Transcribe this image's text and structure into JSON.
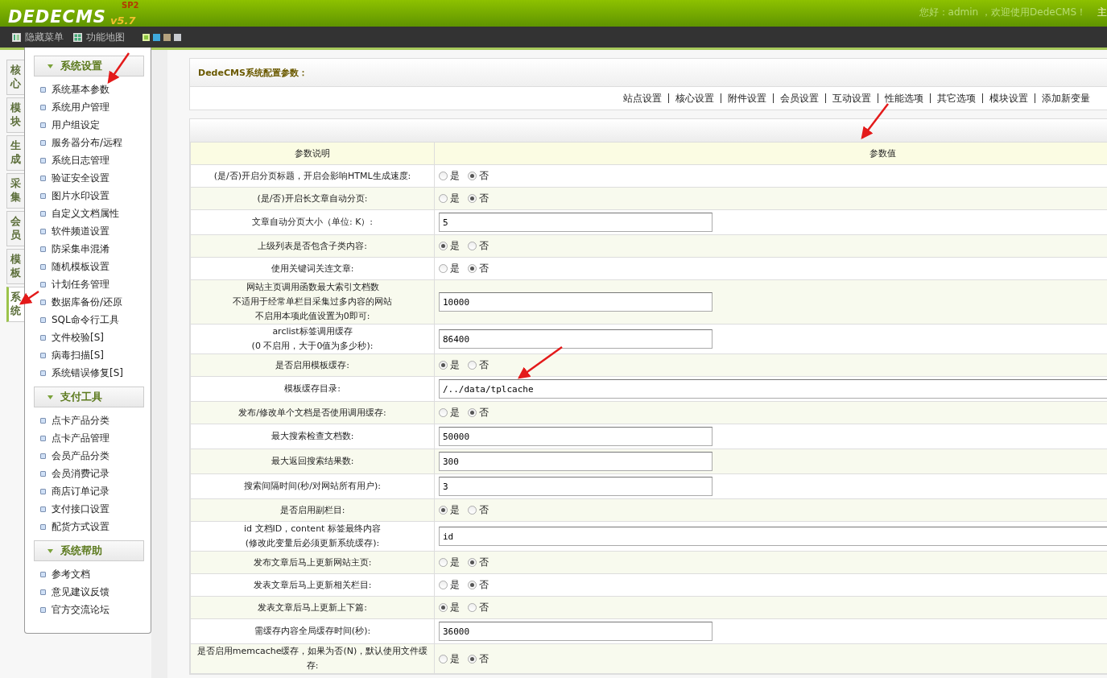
{
  "header": {
    "logo": "DEDECMS",
    "version": "v5.7",
    "edition": "SP2",
    "greeting": "您好：admin ，欢迎使用DedeCMS！",
    "cut_link": "主"
  },
  "toolbar": {
    "items": [
      {
        "kind": "hide",
        "label": "隐藏菜单"
      },
      {
        "kind": "map",
        "label": "功能地图"
      }
    ],
    "skins": [
      {
        "color": "#8cc63f",
        "selected": true
      },
      {
        "color": "#3fa9dc",
        "selected": false
      },
      {
        "color": "#b5a27e",
        "selected": false
      },
      {
        "color": "#c8cbd0",
        "selected": false
      }
    ]
  },
  "side_tabs": [
    {
      "label": "核心",
      "selected": false
    },
    {
      "label": "模块",
      "selected": false
    },
    {
      "label": "生成",
      "selected": false
    },
    {
      "label": "采集",
      "selected": false
    },
    {
      "label": "会员",
      "selected": false
    },
    {
      "label": "模板",
      "selected": false
    },
    {
      "label": "系统",
      "selected": true
    }
  ],
  "sidebar": {
    "groups": [
      {
        "title": "系统设置",
        "items": [
          "系统基本参数",
          "系统用户管理",
          "用户组设定",
          "服务器分布/远程",
          "系统日志管理",
          "验证安全设置",
          "图片水印设置",
          "自定义文档属性",
          "软件频道设置",
          "防采集串混淆",
          "随机模板设置",
          "计划任务管理",
          "数据库备份/还原",
          "SQL命令行工具",
          "文件校验[S]",
          "病毒扫描[S]",
          "系统错误修复[S]"
        ]
      },
      {
        "title": "支付工具",
        "items": [
          "点卡产品分类",
          "点卡产品管理",
          "会员产品分类",
          "会员消费记录",
          "商店订单记录",
          "支付接口设置",
          "配货方式设置"
        ]
      },
      {
        "title": "系统帮助",
        "items": [
          "参考文档",
          "意见建议反馈",
          "官方交流论坛"
        ]
      }
    ]
  },
  "main": {
    "title": "DedeCMS系统配置参数：",
    "nav": [
      "站点设置",
      "核心设置",
      "附件设置",
      "会员设置",
      "互动设置",
      "性能选项",
      "其它选项",
      "模块设置",
      "添加新变量"
    ],
    "table": {
      "columns": [
        "参数说明",
        "参数值"
      ],
      "rows": [
        {
          "label": "(是/否)开启分页标题，开启会影响HTML生成速度:",
          "kind": "radio",
          "options": [
            {
              "label": "是",
              "selected": false
            },
            {
              "label": "否",
              "selected": true
            }
          ]
        },
        {
          "label": "(是/否)开启长文章自动分页:",
          "kind": "radio",
          "options": [
            {
              "label": "是",
              "selected": false
            },
            {
              "label": "否",
              "selected": true
            }
          ]
        },
        {
          "label": "文章自动分页大小（单位: K）:",
          "kind": "text",
          "value": "5"
        },
        {
          "label": "上级列表是否包含子类内容:",
          "kind": "radio",
          "options": [
            {
              "label": "是",
              "selected": true
            },
            {
              "label": "否",
              "selected": false
            }
          ]
        },
        {
          "label": "使用关键词关连文章:",
          "kind": "radio",
          "options": [
            {
              "label": "是",
              "selected": false
            },
            {
              "label": "否",
              "selected": true
            }
          ]
        },
        {
          "label_lines": [
            "网站主页调用函数最大索引文档数",
            "不适用于经常单栏目采集过多内容的网站",
            "不启用本项此值设置为0即可:"
          ],
          "kind": "text",
          "value": "10000"
        },
        {
          "label_lines": [
            "arclist标签调用缓存",
            "(0 不启用，大于0值为多少秒):"
          ],
          "kind": "text",
          "value": "86400"
        },
        {
          "label": "是否启用模板缓存:",
          "kind": "radio",
          "options": [
            {
              "label": "是",
              "selected": true
            },
            {
              "label": "否",
              "selected": false
            }
          ]
        },
        {
          "label": "模板缓存目录:",
          "kind": "long_text",
          "value": "/../data/tplcache"
        },
        {
          "label": "发布/修改单个文档是否使用调用缓存:",
          "kind": "radio",
          "options": [
            {
              "label": "是",
              "selected": false
            },
            {
              "label": "否",
              "selected": true
            }
          ]
        },
        {
          "label": "最大搜索检查文档数:",
          "kind": "text",
          "value": "50000"
        },
        {
          "label": "最大返回搜索结果数:",
          "kind": "text",
          "value": "300"
        },
        {
          "label": "搜索间隔时间(秒/对网站所有用户):",
          "kind": "text",
          "value": "3"
        },
        {
          "label": "是否启用副栏目:",
          "kind": "radio",
          "options": [
            {
              "label": "是",
              "selected": true
            },
            {
              "label": "否",
              "selected": false
            }
          ]
        },
        {
          "label_lines": [
            "id 文档ID，content 标签最终内容",
            "(修改此变量后必须更新系统缓存):"
          ],
          "kind": "long_text",
          "value": "id"
        },
        {
          "label": "发布文章后马上更新网站主页:",
          "kind": "radio",
          "options": [
            {
              "label": "是",
              "selected": false
            },
            {
              "label": "否",
              "selected": true
            }
          ]
        },
        {
          "label": "发表文章后马上更新相关栏目:",
          "kind": "radio",
          "options": [
            {
              "label": "是",
              "selected": false
            },
            {
              "label": "否",
              "selected": true
            }
          ]
        },
        {
          "label": "发表文章后马上更新上下篇:",
          "kind": "radio",
          "options": [
            {
              "label": "是",
              "selected": true
            },
            {
              "label": "否",
              "selected": false
            }
          ]
        },
        {
          "label": "需缓存内容全局缓存时间(秒):",
          "kind": "text",
          "value": "36000"
        },
        {
          "label": "是否启用memcache缓存，如果为否(N)，默认使用文件缓存:",
          "kind": "radio",
          "options": [
            {
              "label": "是",
              "selected": false
            },
            {
              "label": "否",
              "selected": true
            }
          ]
        }
      ]
    }
  }
}
